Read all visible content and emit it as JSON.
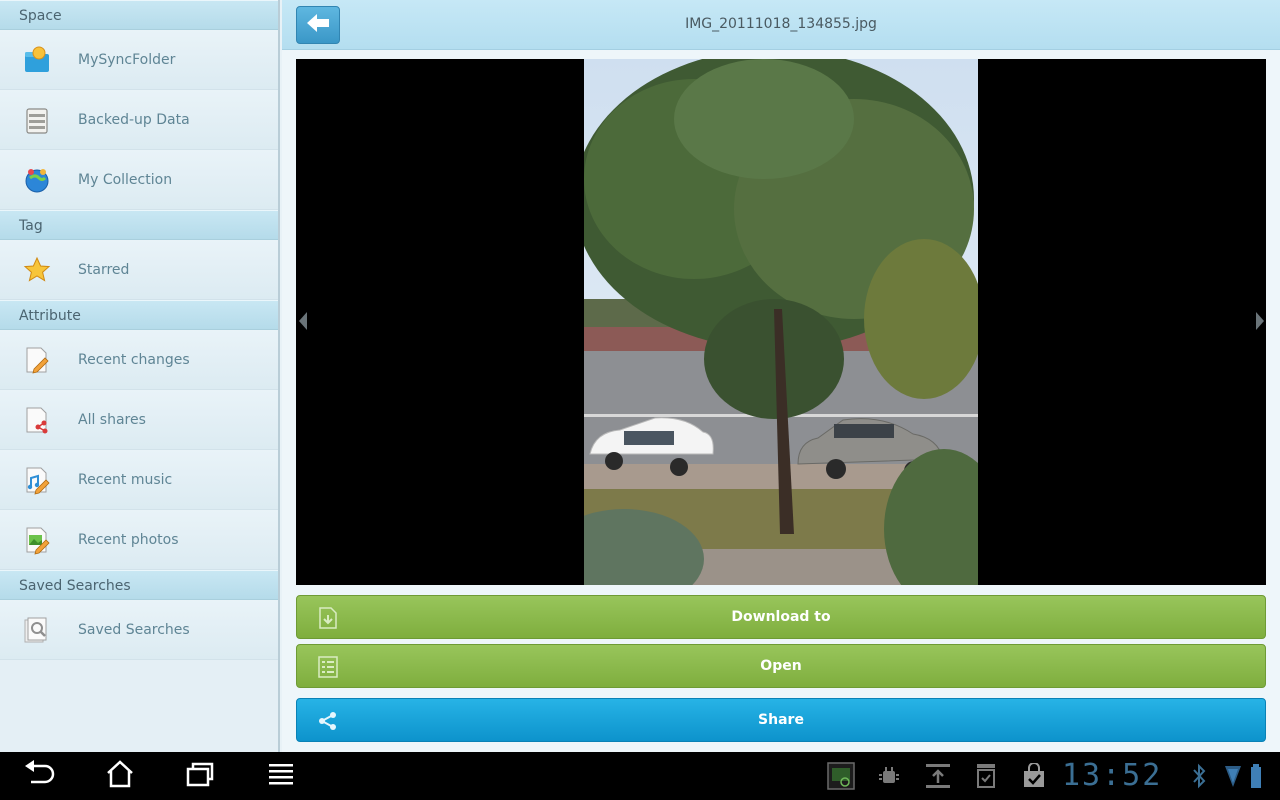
{
  "sidebar": {
    "sections": [
      {
        "header": "Space",
        "items": [
          {
            "label": "MySyncFolder",
            "icon": "folder-sync-icon"
          },
          {
            "label": "Backed-up Data",
            "icon": "backup-icon"
          },
          {
            "label": "My Collection",
            "icon": "collection-globe-icon"
          }
        ]
      },
      {
        "header": "Tag",
        "items": [
          {
            "label": "Starred",
            "icon": "star-icon"
          }
        ]
      },
      {
        "header": "Attribute",
        "items": [
          {
            "label": "Recent changes",
            "icon": "document-edit-icon"
          },
          {
            "label": "All shares",
            "icon": "document-share-icon"
          },
          {
            "label": "Recent music",
            "icon": "music-document-icon"
          },
          {
            "label": "Recent photos",
            "icon": "photo-document-icon"
          }
        ]
      },
      {
        "header": "Saved Searches",
        "items": [
          {
            "label": "Saved Searches",
            "icon": "search-document-icon"
          }
        ]
      }
    ]
  },
  "header": {
    "title": "IMG_20111018_134855.jpg"
  },
  "actions": {
    "download_label": "Download to",
    "open_label": "Open",
    "share_label": "Share"
  },
  "system_bar": {
    "clock": "13:52"
  },
  "colors": {
    "green_button": "#8bbb4c",
    "blue_button": "#18a3da",
    "sidebar_header": "#bfe2f0",
    "topbar": "#bde3f3"
  }
}
